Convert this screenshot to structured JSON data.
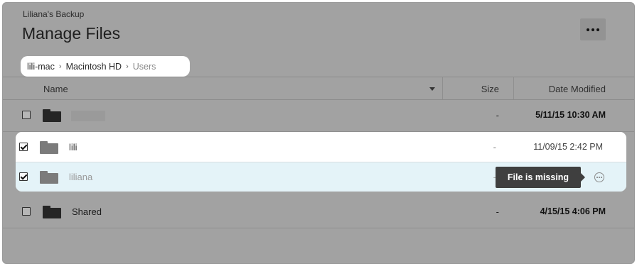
{
  "app": {
    "subtitle": "Liliana's Backup",
    "title": "Manage Files"
  },
  "toolbar": {
    "more_icon": "more-horizontal-icon"
  },
  "breadcrumb": [
    {
      "label": "lili-mac"
    },
    {
      "label": "Macintosh HD"
    },
    {
      "label": "Users"
    }
  ],
  "table": {
    "columns": {
      "name": "Name",
      "size": "Size",
      "date": "Date Modified"
    },
    "sort": {
      "column": "name",
      "direction": "descending"
    },
    "rows": [
      {
        "name": "",
        "name_redacted": true,
        "size": "-",
        "date": "5/11/15 10:30 AM",
        "checked": false,
        "icon": "folder-icon"
      },
      {
        "name": "lili",
        "size": "-",
        "date": "11/09/15 2:42 PM",
        "checked": true,
        "icon": "folder-icon"
      },
      {
        "name": "liliana",
        "size": "-",
        "date": "",
        "checked": true,
        "icon": "folder-icon",
        "status": "missing"
      },
      {
        "name": "Shared",
        "size": "-",
        "date": "4/15/15 4:06 PM",
        "checked": false,
        "icon": "folder-icon"
      }
    ]
  },
  "tooltip": {
    "text": "File is missing"
  },
  "colors": {
    "overlay": "#a2a2a2",
    "selected_row": "#e4f3f8",
    "tooltip_bg": "#3f3f3f"
  }
}
